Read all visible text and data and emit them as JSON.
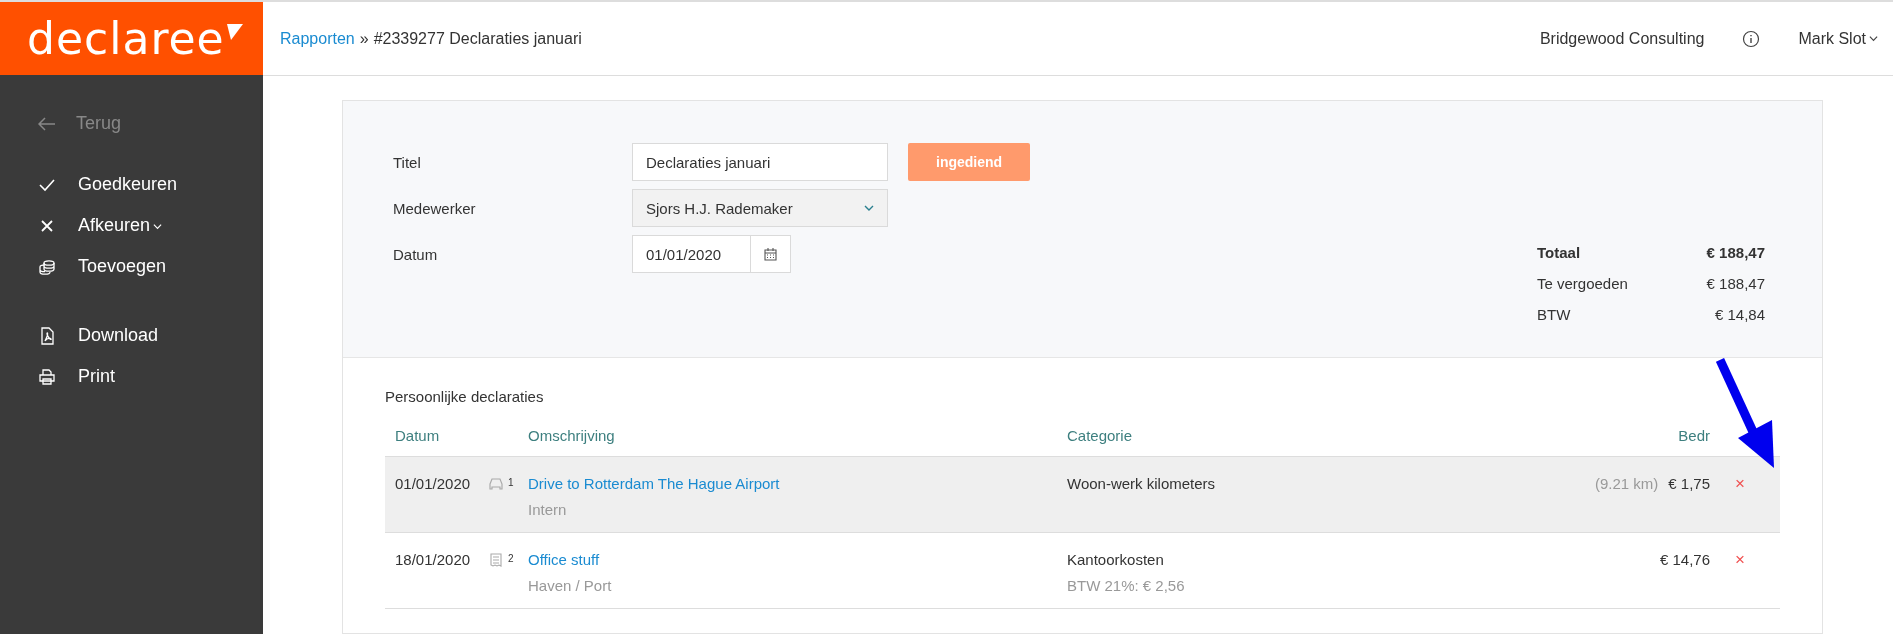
{
  "logo": {
    "text": "declaree"
  },
  "header": {
    "breadcrumb_link": "Rapporten",
    "breadcrumb_separator": "»",
    "breadcrumb_current": "#2339277 Declaraties januari",
    "company": "Bridgewood Consulting",
    "user": "Mark Slot"
  },
  "sidebar": {
    "back": "Terug",
    "groups": [
      [
        {
          "label": "Goedkeuren",
          "kind": "check",
          "dropdown": false
        },
        {
          "label": "Afkeuren",
          "kind": "cross",
          "dropdown": true
        },
        {
          "label": "Toevoegen",
          "kind": "coins",
          "dropdown": false
        }
      ],
      [
        {
          "label": "Download",
          "kind": "pdf",
          "dropdown": false
        },
        {
          "label": "Print",
          "kind": "printer",
          "dropdown": false
        }
      ]
    ]
  },
  "form": {
    "fields": [
      {
        "label": "Titel",
        "kind": "text",
        "value": "Declaraties januari"
      },
      {
        "label": "Medewerker",
        "kind": "select",
        "value": "Sjors H.J. Rademaker"
      },
      {
        "label": "Datum",
        "kind": "date",
        "value": "01/01/2020"
      }
    ],
    "status": "ingediend"
  },
  "totals": [
    {
      "label": "Totaal",
      "value": "€ 188,47",
      "bold": true
    },
    {
      "label": "Te vergoeden",
      "value": "€ 188,47",
      "bold": false
    },
    {
      "label": "BTW",
      "value": "€ 14,84",
      "bold": false
    }
  ],
  "section_title": "Persoonlijke declaraties",
  "table": {
    "columns": [
      "Datum",
      "Omschrijving",
      "Categorie",
      "Bedr"
    ],
    "rows": [
      {
        "date": "01/01/2020",
        "kind": "car",
        "count": "1",
        "description": "Drive to Rotterdam The Hague Airport",
        "sub": "Intern",
        "category": "Woon-werk kilometers",
        "category_sub": "",
        "extra": "(9.21 km)",
        "amount": "€ 1,75",
        "delete": "×",
        "selected": true
      },
      {
        "date": "18/01/2020",
        "kind": "receipt",
        "count": "2",
        "description": "Office stuff",
        "sub": "Haven / Port",
        "category": "Kantoorkosten",
        "category_sub": "BTW 21%: € 2,56",
        "extra": "",
        "amount": "€ 14,76",
        "delete": "×",
        "selected": false
      }
    ]
  }
}
